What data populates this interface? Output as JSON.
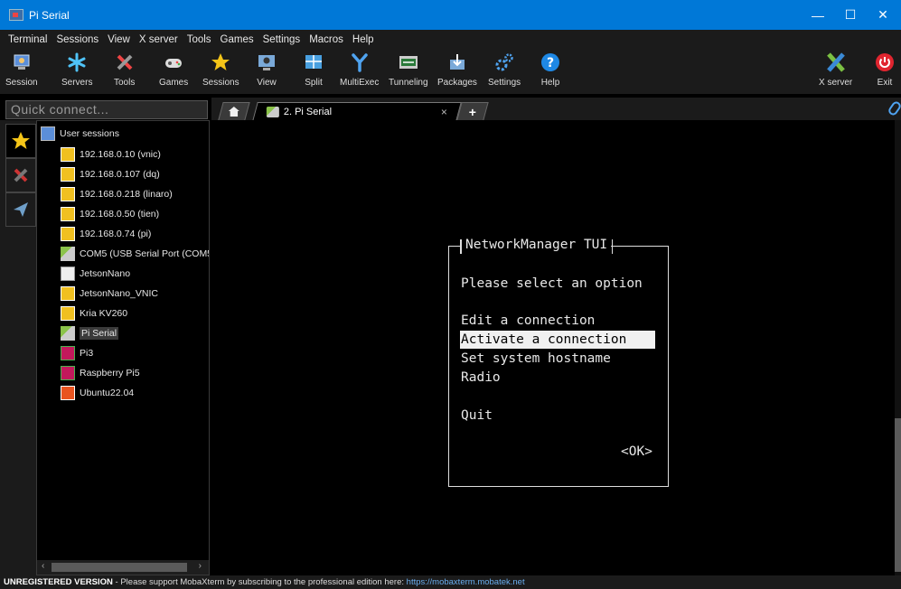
{
  "window": {
    "title": "Pi Serial",
    "controls": [
      "—",
      "☐",
      "✕"
    ]
  },
  "menu": [
    "Terminal",
    "Sessions",
    "View",
    "X server",
    "Tools",
    "Games",
    "Settings",
    "Macros",
    "Help"
  ],
  "toolbar": {
    "session": "Session",
    "servers": "Servers",
    "tools": "Tools",
    "games": "Games",
    "sessions": "Sessions",
    "view": "View",
    "split": "Split",
    "multiexec": "MultiExec",
    "tunneling": "Tunneling",
    "packages": "Packages",
    "settings": "Settings",
    "help": "Help",
    "xserver": "X server",
    "exit": "Exit"
  },
  "quick_connect": {
    "placeholder": "Quick connect..."
  },
  "tabs": {
    "active_label": "2. Pi Serial",
    "close": "×",
    "new": "+"
  },
  "sessions_tree": {
    "root": "User sessions",
    "items": [
      {
        "label": "192.168.0.10 (vnic)",
        "icon": "ssh-key-icon"
      },
      {
        "label": "192.168.0.107 (dq)",
        "icon": "ssh-key-icon"
      },
      {
        "label": "192.168.0.218 (linaro)",
        "icon": "ssh-key-icon"
      },
      {
        "label": "192.168.0.50 (tien)",
        "icon": "ssh-key-icon"
      },
      {
        "label": "192.168.0.74 (pi)",
        "icon": "ssh-key-icon"
      },
      {
        "label": "COM5  (USB Serial Port (COM5",
        "icon": "serial-plug-icon"
      },
      {
        "label": "JetsonNano",
        "icon": "linux-icon"
      },
      {
        "label": "JetsonNano_VNIC",
        "icon": "ssh-key-icon"
      },
      {
        "label": "Kria KV260",
        "icon": "ssh-key-icon"
      },
      {
        "label": "Pi Serial",
        "icon": "serial-plug-icon"
      },
      {
        "label": "Pi3",
        "icon": "raspberry-icon"
      },
      {
        "label": "Raspberry Pi5",
        "icon": "raspberry-icon"
      },
      {
        "label": "Ubuntu22.04",
        "icon": "ubuntu-icon"
      }
    ]
  },
  "nmtui": {
    "title": "NetworkManager TUI",
    "prompt": "Please select an option",
    "options": [
      "Edit a connection",
      "Activate a connection",
      "Set system hostname",
      "Radio"
    ],
    "quit": "Quit",
    "ok": "<OK>",
    "selected_index": 1
  },
  "statusbar": {
    "bold": "UNREGISTERED VERSION",
    "text": "  -  Please support MobaXterm by subscribing to the professional edition here:  ",
    "link": "https://mobaxterm.mobatek.net"
  },
  "colors": {
    "titlebar": "#0078d7",
    "background": "#1b1b1b",
    "terminal": "#000000",
    "highlight": "#f0f0f0"
  }
}
